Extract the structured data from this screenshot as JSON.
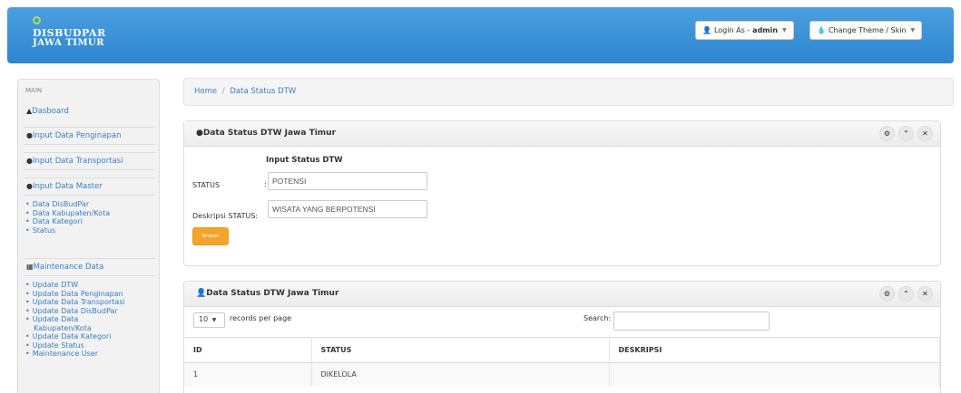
{
  "header": {
    "logo_line1": "DISBUDPAR",
    "logo_line2": "JAWA TIMUR",
    "login_prefix": "Login As - ",
    "login_user": "admin",
    "theme_label": "Change Theme / Skin"
  },
  "sidebar": {
    "heading": "MAIN",
    "items": [
      {
        "label": "Dasboard",
        "icon": "home-icon"
      },
      {
        "label": "Input Data Penginapan",
        "icon": "chevron-circle-icon"
      },
      {
        "label": "Input Data Transportasi",
        "icon": "chevron-circle-icon"
      },
      {
        "label": "Input Data Master",
        "icon": "chevron-circle-icon"
      }
    ],
    "master_sub": [
      "Data DisBudPar",
      "Data Kabupaten/Kota",
      "Data Kategori",
      "Status"
    ],
    "maintenance_label": "Maintenance Data",
    "maintenance_sub": [
      "Update DTW",
      "Update Data Penginapan",
      "Update Data Transportasi",
      "Update Data DisBudPar",
      "Update Data",
      "Kabupaten/Kota",
      "Update Data Kategori",
      "Update Status",
      "Maintenance User"
    ]
  },
  "breadcrumb": {
    "home": "Home",
    "separator": "/",
    "current": "Data Status DTW"
  },
  "form_box": {
    "title": "Data Status DTW Jawa Timur",
    "form_title": "Input Status DTW",
    "status_label": "STATUS",
    "status_colon": ":",
    "status_value": "POTENSI",
    "desc_label": "Deskripsi STATUS:",
    "desc_value": "WISATA YANG BERPOTENSI",
    "save_button": "Simpan"
  },
  "table_box": {
    "title": "Data Status DTW Jawa Timur",
    "page_size": "10",
    "records_per_page": "records per page",
    "search_label": "Search:",
    "columns": [
      "ID",
      "STATUS",
      "DESKRIPSI"
    ],
    "rows": [
      {
        "id": "1",
        "status": "DIKELOLA",
        "deskripsi": ""
      }
    ]
  },
  "colors": {
    "header_blue": "#2f86cf",
    "link_blue": "#3a7cc1",
    "button_orange": "#f4a42a"
  }
}
